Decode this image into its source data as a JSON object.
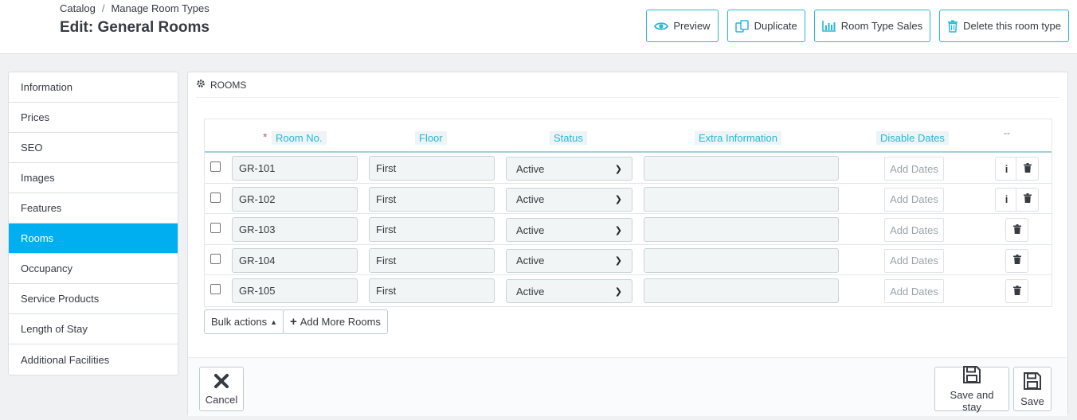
{
  "header": {
    "breadcrumb": [
      "Catalog",
      "Manage Room Types"
    ],
    "breadcrumb_sep": "/",
    "title": "Edit: General Rooms",
    "toolbar": {
      "preview": "Preview",
      "duplicate": "Duplicate",
      "room_type_sales": "Room Type Sales",
      "delete": "Delete this room type"
    }
  },
  "sidebar": {
    "items": [
      {
        "label": "Information",
        "active": false
      },
      {
        "label": "Prices",
        "active": false
      },
      {
        "label": "SEO",
        "active": false
      },
      {
        "label": "Images",
        "active": false
      },
      {
        "label": "Features",
        "active": false
      },
      {
        "label": "Rooms",
        "active": true
      },
      {
        "label": "Occupancy",
        "active": false
      },
      {
        "label": "Service Products",
        "active": false
      },
      {
        "label": "Length of Stay",
        "active": false
      },
      {
        "label": "Additional Facilities",
        "active": false
      }
    ]
  },
  "panel": {
    "heading": "ROOMS",
    "columns": {
      "required_mark": "*",
      "room_no": "Room No.",
      "floor": "Floor",
      "status": "Status",
      "extra_info": "Extra Information",
      "disable_dates": "Disable Dates",
      "actions": "--"
    },
    "rows": [
      {
        "room_no": "GR-101",
        "floor": "First",
        "status": "Active",
        "extra_info": "",
        "disable_dates": "Add Dates",
        "has_info": true
      },
      {
        "room_no": "GR-102",
        "floor": "First",
        "status": "Active",
        "extra_info": "",
        "disable_dates": "Add Dates",
        "has_info": true
      },
      {
        "room_no": "GR-103",
        "floor": "First",
        "status": "Active",
        "extra_info": "",
        "disable_dates": "Add Dates",
        "has_info": false
      },
      {
        "room_no": "GR-104",
        "floor": "First",
        "status": "Active",
        "extra_info": "",
        "disable_dates": "Add Dates",
        "has_info": false
      },
      {
        "room_no": "GR-105",
        "floor": "First",
        "status": "Active",
        "extra_info": "",
        "disable_dates": "Add Dates",
        "has_info": false
      }
    ],
    "bulk_actions": "Bulk actions",
    "add_more": "Add More Rooms",
    "footer": {
      "cancel": "Cancel",
      "save_and_stay": "Save and stay",
      "save": "Save"
    }
  },
  "colors": {
    "accent": "#25b9d7",
    "active_tab": "#00aff0"
  }
}
